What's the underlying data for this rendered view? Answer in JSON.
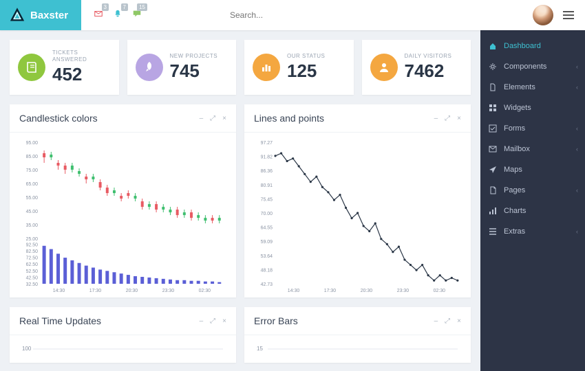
{
  "brand": "Baxster",
  "search": {
    "placeholder": "Search..."
  },
  "notifications": [
    {
      "icon": "mail",
      "count": "3",
      "color": "#e85b63"
    },
    {
      "icon": "bell",
      "count": "7",
      "color": "#3ec0d1"
    },
    {
      "icon": "chat",
      "count": "15",
      "color": "#8fc866"
    }
  ],
  "cards": [
    {
      "label": "TICKETS ANSWERED",
      "value": "452",
      "icon": "book",
      "bg": "#8fc73e"
    },
    {
      "label": "NEW PROJECTS",
      "value": "745",
      "icon": "rocket",
      "bg": "#b8a5e3"
    },
    {
      "label": "OUR STATUS",
      "value": "125",
      "icon": "bars",
      "bg": "#f4a740"
    },
    {
      "label": "DAILY VISITORS",
      "value": "7462",
      "icon": "user",
      "bg": "#f4a740"
    }
  ],
  "sidebar": [
    {
      "label": "Dashboard",
      "icon": "home",
      "active": true,
      "expandable": false
    },
    {
      "label": "Components",
      "icon": "cog",
      "expandable": true
    },
    {
      "label": "Elements",
      "icon": "file",
      "expandable": true
    },
    {
      "label": "Widgets",
      "icon": "grid",
      "expandable": false
    },
    {
      "label": "Forms",
      "icon": "check",
      "expandable": true
    },
    {
      "label": "Mailbox",
      "icon": "envelope",
      "expandable": true
    },
    {
      "label": "Maps",
      "icon": "arrow",
      "expandable": false
    },
    {
      "label": "Pages",
      "icon": "page",
      "expandable": true
    },
    {
      "label": "Charts",
      "icon": "chart",
      "expandable": false
    },
    {
      "label": "Extras",
      "icon": "list",
      "expandable": true
    }
  ],
  "panels": {
    "candlestick": {
      "title": "Candlestick colors"
    },
    "lines": {
      "title": "Lines and points"
    },
    "realtime": {
      "title": "Real Time Updates"
    },
    "errorbars": {
      "title": "Error Bars"
    }
  },
  "panel_actions": {
    "minimize": "–",
    "expand": "⤢",
    "close": "×"
  },
  "chart_data": {
    "candlestick": {
      "type": "candlestick",
      "ylim_upper": [
        25,
        95
      ],
      "ylim_lower": [
        32.5,
        92.5
      ],
      "y_ticks_upper": [
        25.0,
        35.0,
        45.0,
        55.0,
        65.0,
        75.0,
        85.0,
        95.0
      ],
      "y_ticks_lower": [
        32.5,
        42.5,
        52.5,
        62.5,
        72.5,
        82.5,
        92.5
      ],
      "x_ticks": [
        "14:30",
        "17:30",
        "20:30",
        "23:30",
        "02:30"
      ],
      "candles": [
        {
          "o": 87,
          "c": 84,
          "l": 80,
          "h": 89,
          "up": false
        },
        {
          "o": 84,
          "c": 86,
          "l": 82,
          "h": 88,
          "up": true
        },
        {
          "o": 80,
          "c": 78,
          "l": 75,
          "h": 82,
          "up": false
        },
        {
          "o": 78,
          "c": 75,
          "l": 72,
          "h": 80,
          "up": false
        },
        {
          "o": 75,
          "c": 78,
          "l": 73,
          "h": 80,
          "up": true
        },
        {
          "o": 72,
          "c": 74,
          "l": 70,
          "h": 76,
          "up": true
        },
        {
          "o": 70,
          "c": 68,
          "l": 65,
          "h": 72,
          "up": false
        },
        {
          "o": 68,
          "c": 70,
          "l": 66,
          "h": 72,
          "up": true
        },
        {
          "o": 66,
          "c": 62,
          "l": 60,
          "h": 68,
          "up": false
        },
        {
          "o": 62,
          "c": 58,
          "l": 56,
          "h": 64,
          "up": false
        },
        {
          "o": 58,
          "c": 60,
          "l": 56,
          "h": 62,
          "up": true
        },
        {
          "o": 56,
          "c": 54,
          "l": 52,
          "h": 58,
          "up": false
        },
        {
          "o": 58,
          "c": 56,
          "l": 54,
          "h": 60,
          "up": false
        },
        {
          "o": 54,
          "c": 56,
          "l": 52,
          "h": 58,
          "up": true
        },
        {
          "o": 52,
          "c": 48,
          "l": 46,
          "h": 54,
          "up": false
        },
        {
          "o": 48,
          "c": 50,
          "l": 46,
          "h": 52,
          "up": true
        },
        {
          "o": 50,
          "c": 46,
          "l": 44,
          "h": 52,
          "up": false
        },
        {
          "o": 46,
          "c": 48,
          "l": 44,
          "h": 50,
          "up": true
        },
        {
          "o": 44,
          "c": 46,
          "l": 42,
          "h": 48,
          "up": true
        },
        {
          "o": 46,
          "c": 42,
          "l": 40,
          "h": 48,
          "up": false
        },
        {
          "o": 42,
          "c": 44,
          "l": 40,
          "h": 46,
          "up": true
        },
        {
          "o": 44,
          "c": 40,
          "l": 38,
          "h": 46,
          "up": false
        },
        {
          "o": 40,
          "c": 42,
          "l": 38,
          "h": 44,
          "up": true
        },
        {
          "o": 38,
          "c": 40,
          "l": 36,
          "h": 42,
          "up": true
        },
        {
          "o": 40,
          "c": 38,
          "l": 36,
          "h": 42,
          "up": false
        },
        {
          "o": 38,
          "c": 40,
          "l": 36,
          "h": 42,
          "up": true
        }
      ],
      "volume": [
        90,
        85,
        78,
        72,
        68,
        64,
        60,
        57,
        54,
        52,
        50,
        48,
        46,
        44,
        43,
        42,
        41,
        40,
        39,
        38,
        38,
        37,
        37,
        36,
        36,
        35
      ]
    },
    "lines": {
      "type": "line",
      "ylim": [
        42.73,
        97.27
      ],
      "y_ticks": [
        42.73,
        48.18,
        53.64,
        59.09,
        64.55,
        70.0,
        75.45,
        80.91,
        86.36,
        91.82,
        97.27
      ],
      "x_ticks": [
        "14:30",
        "17:30",
        "20:30",
        "23:30",
        "02:30"
      ],
      "values": [
        92,
        93,
        90,
        91,
        88,
        85,
        82,
        84,
        80,
        78,
        75,
        77,
        72,
        68,
        70,
        65,
        63,
        66,
        60,
        58,
        55,
        57,
        52,
        50,
        48,
        50,
        46,
        44,
        46,
        44,
        45,
        44
      ]
    },
    "realtime": {
      "type": "line",
      "ylim": [
        0,
        100
      ],
      "values": []
    },
    "errorbars": {
      "type": "line",
      "ylim": [
        0,
        15
      ],
      "values": []
    }
  }
}
